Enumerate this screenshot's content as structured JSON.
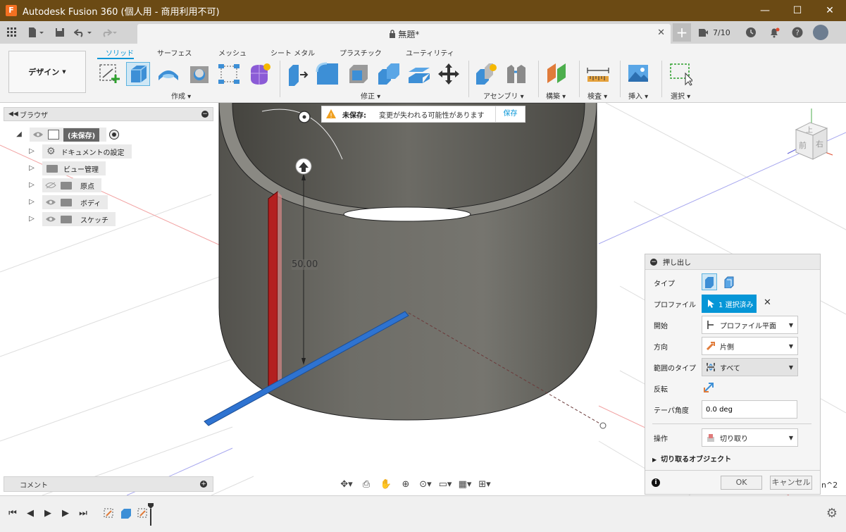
{
  "window": {
    "app_icon": "F",
    "title": "Autodesk Fusion 360 (個人用 - 商用利用不可)",
    "minimize": "—",
    "maximize": "☐",
    "close": "✕"
  },
  "document_tab": {
    "title": "無題*",
    "close": "✕"
  },
  "quick_access": {
    "jobs": "7/10"
  },
  "ribbon": {
    "workspace_label": "デザイン",
    "tabs": [
      "ソリッド",
      "サーフェス",
      "メッシュ",
      "シート メタル",
      "プラスチック",
      "ユーティリティ"
    ],
    "groups": [
      "作成",
      "修正",
      "アセンブリ",
      "構築",
      "検査",
      "挿入",
      "選択"
    ]
  },
  "browser": {
    "title": "ブラウザ",
    "root": "(未保存)",
    "items": [
      "ドキュメントの設定",
      "ビュー管理",
      "原点",
      "ボディ",
      "スケッチ"
    ]
  },
  "banner": {
    "title": "未保存:",
    "message": "変更が失われる可能性があります",
    "save": "保存"
  },
  "viewport": {
    "dimension": "50.00",
    "corner_text": "n^2",
    "viewcube": {
      "top": "上",
      "front": "前",
      "right": "右"
    }
  },
  "extrude": {
    "title": "押し出し",
    "type_label": "タイプ",
    "profile_label": "プロファイル",
    "profile_value": "1 選択済み",
    "start_label": "開始",
    "start_value": "プロファイル平面",
    "direction_label": "方向",
    "direction_value": "片側",
    "extent_label": "範囲のタイプ",
    "extent_value": "すべて",
    "flip_label": "反転",
    "taper_label": "テーパ角度",
    "taper_value": "0.0 deg",
    "operation_label": "操作",
    "operation_value": "切り取り",
    "objects_to_cut": "切り取るオブジェクト",
    "ok": "OK",
    "cancel": "キャンセル"
  },
  "comments": {
    "title": "コメント"
  },
  "colors": {
    "titlebar": "#6b4a14",
    "accent": "#0696d7",
    "body": "#6e6d67"
  }
}
